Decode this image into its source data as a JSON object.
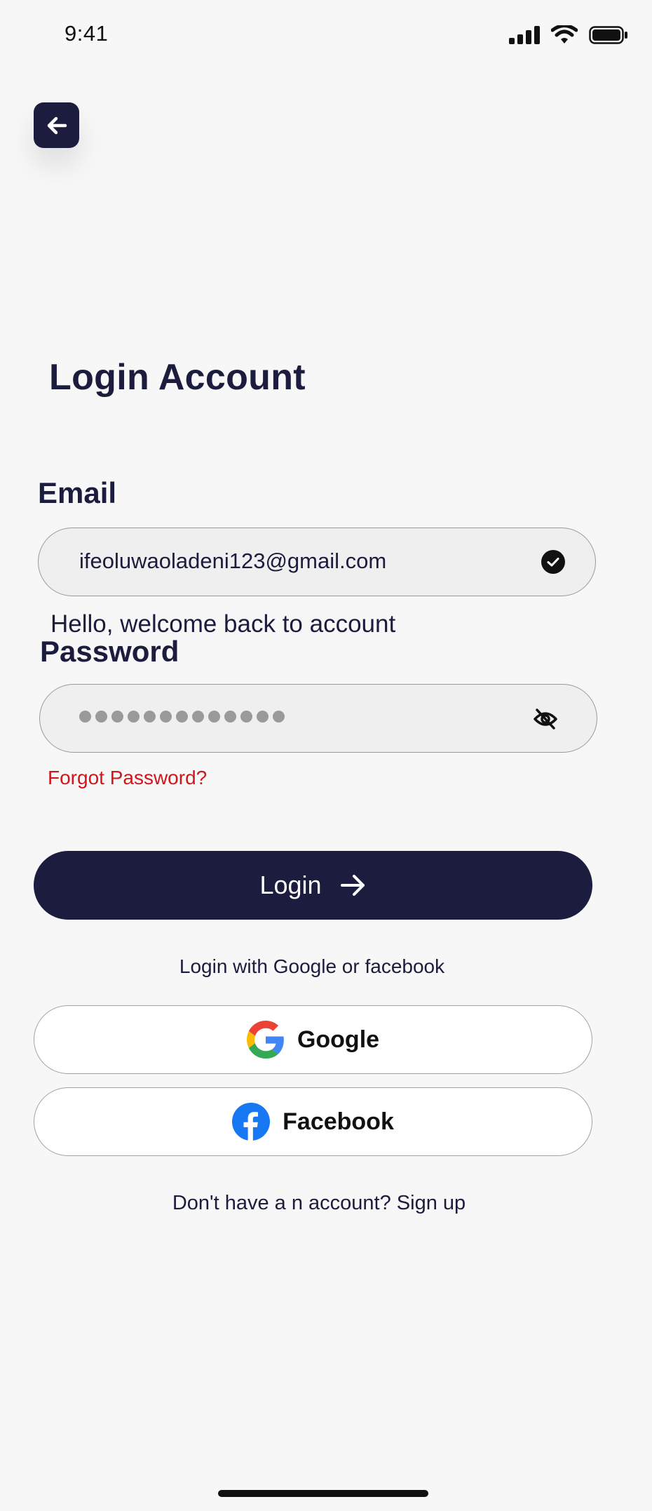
{
  "status_bar": {
    "time": "9:41"
  },
  "header": {
    "title": "Login Account"
  },
  "form": {
    "email_label": "Email",
    "email_value": "ifeoluwaoladeni123@gmail.com",
    "welcome_text": "Hello, welcome back to account",
    "password_label": "Password",
    "password_masked_count": 13,
    "forgot_password": "Forgot Password?",
    "login_button": "Login"
  },
  "social": {
    "caption": "Login with Google or facebook",
    "google_label": "Google",
    "facebook_label": "Facebook"
  },
  "footer": {
    "signup_text": "Don't have a n account? Sign up"
  },
  "colors": {
    "primary": "#1b1c3e",
    "background": "#f7f7f7",
    "field_bg": "#efefef",
    "error_link": "#d1171c",
    "facebook_blue": "#1877f2"
  },
  "icons": [
    "back-arrow-icon",
    "check-circle-icon",
    "eye-off-icon",
    "arrow-right-icon",
    "google-logo-icon",
    "facebook-logo-icon",
    "signal-icon",
    "wifi-icon",
    "battery-icon"
  ]
}
